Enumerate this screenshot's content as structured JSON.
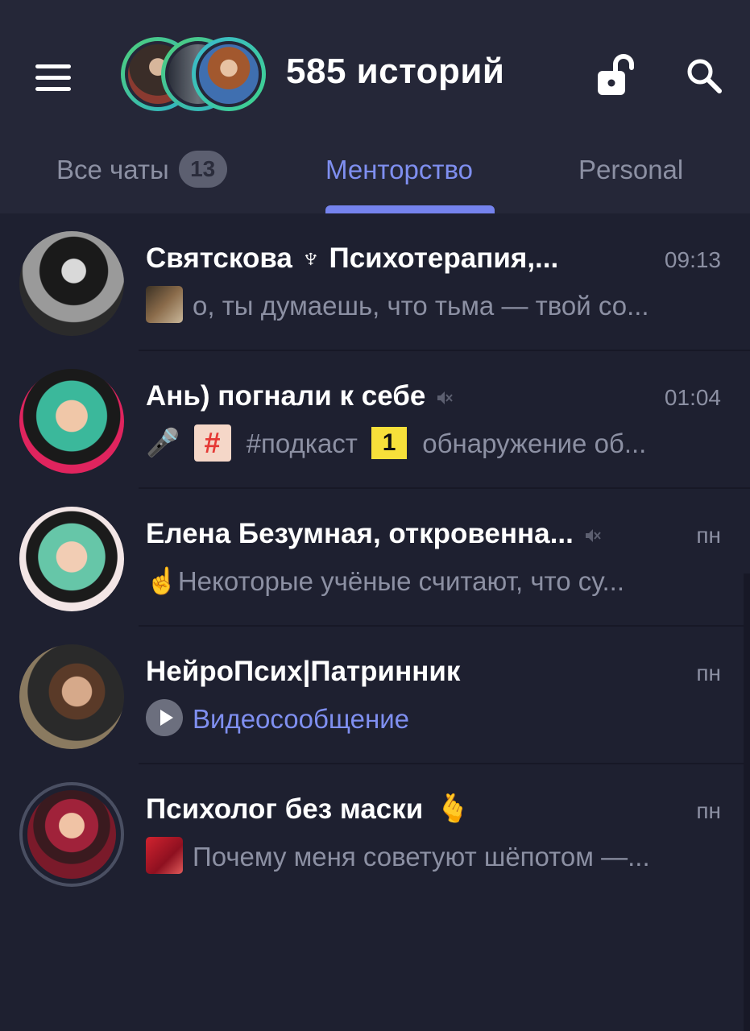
{
  "header": {
    "stories_title": "585 историй",
    "icons": {
      "menu": "menu-icon",
      "lock": "unlock-icon",
      "search": "search-icon"
    }
  },
  "tabs": [
    {
      "label": "Все чаты",
      "badge": "13",
      "active": false
    },
    {
      "label": "Менторство",
      "active": true
    },
    {
      "label": "Personal",
      "active": false
    }
  ],
  "chats": [
    {
      "title": "Святскова ♆ Психотерапия,...",
      "time": "09:13",
      "muted": false,
      "preview": "о, ты думаешь, что тьма — твой со..."
    },
    {
      "title": "Ань) погнали к себе",
      "time": "01:04",
      "muted": true,
      "preview": "#подкаст",
      "preview_tail": "обнаружение  об...",
      "emoji_1": "🎤",
      "emoji_2": "#️⃣",
      "emoji_3": "1"
    },
    {
      "title": "Елена Безумная, откровенна...",
      "time": "пн",
      "muted": true,
      "preview": "Некоторые учёные считают, что су...",
      "emoji_1": "☝️"
    },
    {
      "title": "НейроПсих|Патринник",
      "time": "пн",
      "muted": false,
      "preview": "Видеосообщение"
    },
    {
      "title": "Психолог без маски",
      "time": "пн",
      "muted": false,
      "preview": "Почему меня советуют шёпотом —...",
      "emoji_1": "🫰"
    }
  ],
  "colors": {
    "background": "#1e2030",
    "header": "#252738",
    "accent": "#7f8ff0",
    "muted_text": "#8c90a3",
    "story_ring": "#4fd07a"
  }
}
